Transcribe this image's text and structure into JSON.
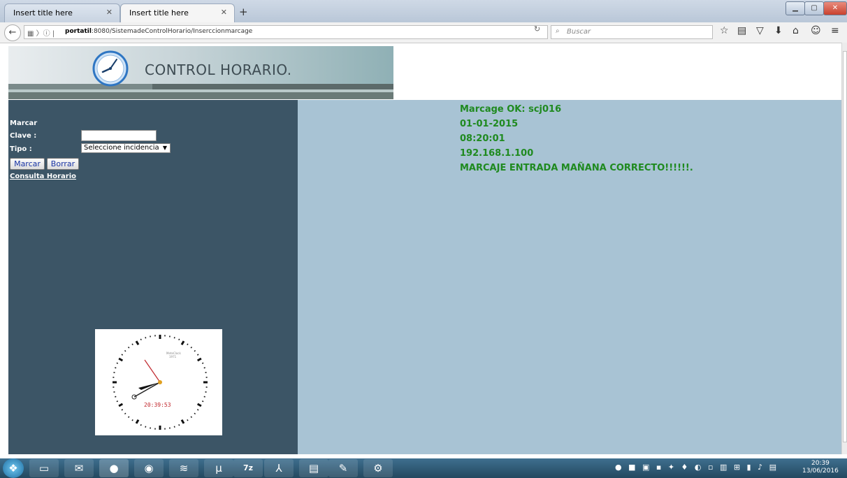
{
  "browser": {
    "tabs": [
      {
        "label": "Insert title here"
      },
      {
        "label": "Insert title here"
      }
    ],
    "url_host": "portatil",
    "url_rest": ":8080/SistemadeControlHorario/Inserccionmarcage",
    "search_placeholder": "Buscar"
  },
  "header": {
    "title": "CONTROL HORARIO."
  },
  "form": {
    "section_label": "Marcar",
    "clave_label": "Clave :",
    "clave_value": "",
    "tipo_label": "Tipo :",
    "tipo_selected": "Seleccione incidencia",
    "marcar_button": "Marcar",
    "borrar_button": "Borrar",
    "consulta_link": "Consulta Horario"
  },
  "clock_widget": {
    "brand": "MeteClock",
    "brand_year": "1971",
    "time": "20:39:53"
  },
  "result": {
    "line1": "Marcage OK: scj016",
    "line2": "01-01-2015",
    "line3": "08:20:01",
    "line4": "192.168.1.100",
    "line5": "MARCAJE ENTRADA MAÑANA CORRECTO!!!!!!."
  },
  "taskbar": {
    "apps": [
      "start-orb",
      "file-explorer-icon",
      "thunderbird-icon",
      "firefox-icon",
      "chrome-icon",
      "spotify-icon",
      "utorrent-icon",
      "7zip-icon",
      "acrobat-icon",
      "notepad-icon",
      "paint-icon",
      "app-icon"
    ],
    "app_7zip_label": "7z",
    "clock_time": "20:39",
    "clock_date": "13/06/2016"
  },
  "colors": {
    "sidebar": "#3c5566",
    "content": "#a8c3d4",
    "success_text": "#1f8a1f"
  }
}
